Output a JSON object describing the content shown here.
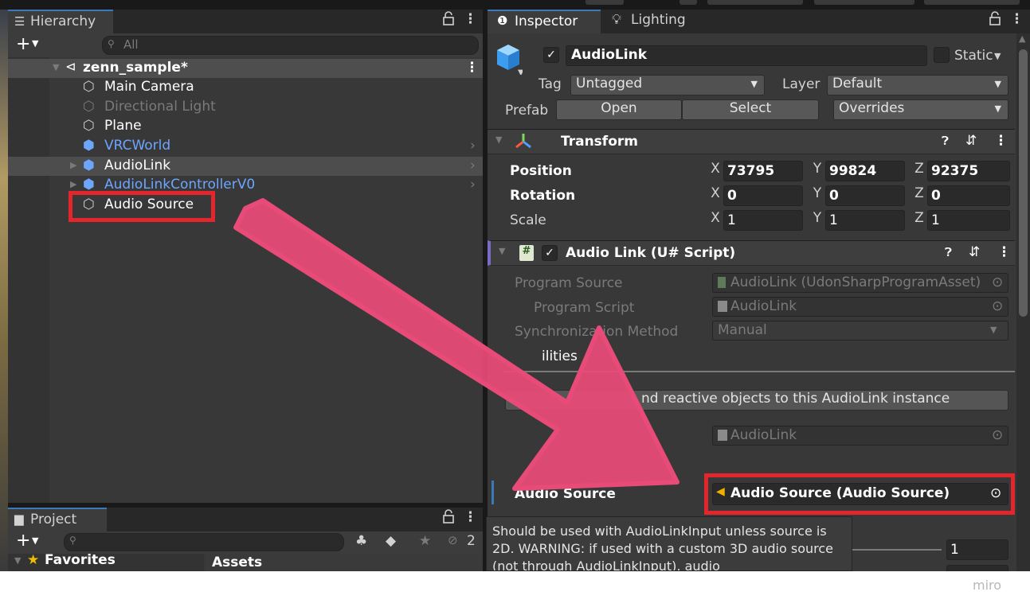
{
  "hierarchy": {
    "tab_label": "Hierarchy",
    "search_placeholder": "All",
    "scene_name": "zenn_sample*",
    "items": [
      {
        "label": "Main Camera"
      },
      {
        "label": "Directional Light"
      },
      {
        "label": "Plane"
      },
      {
        "label": "VRCWorld"
      },
      {
        "label": "AudioLink"
      },
      {
        "label": "AudioLinkControllerV0"
      },
      {
        "label": "Audio Source"
      }
    ]
  },
  "project": {
    "tab_label": "Project",
    "hidden_count": "2",
    "favorites_label": "Favorites",
    "assets_label": "Assets"
  },
  "inspector": {
    "tabs": [
      "Inspector",
      "Lighting"
    ],
    "object_name": "AudioLink",
    "static_label": "Static",
    "tag_label": "Tag",
    "tag_value": "Untagged",
    "layer_label": "Layer",
    "layer_value": "Default",
    "prefab_label": "Prefab",
    "open_label": "Open",
    "select_label": "Select",
    "overrides_label": "Overrides",
    "transform": {
      "title": "Transform",
      "position_label": "Position",
      "rotation_label": "Rotation",
      "scale_label": "Scale",
      "axes": [
        "X",
        "Y",
        "Z"
      ],
      "position": [
        "73795",
        "99824",
        "92375"
      ],
      "rotation": [
        "0",
        "0",
        "0"
      ],
      "scale": [
        "1",
        "1",
        "1"
      ]
    },
    "script": {
      "title": "Audio Link (U# Script)",
      "program_source_label": "Program Source",
      "program_source_value": "AudioLink (UdonSharpProgramAsset)",
      "program_script_label": "Program Script",
      "program_script_value": "AudioLink",
      "sync_label": "Synchronization Method",
      "sync_value": "Manual",
      "utilities_label": "ilities",
      "link_button": "nd reactive objects to this AudioLink instance",
      "script_ref_value": "AudioLink",
      "audio_source_label": "Audio Source",
      "audio_source_value": "Audio Source (Audio Source)",
      "tooltip": "Should be used with AudioLinkInput unless source is 2D. WARNING: if used with a custom 3D audio source (not through AudioLinkInput), audio",
      "slider_value": "1"
    }
  },
  "watermark": "miro",
  "colors": {
    "highlight_box": "#e3262b",
    "arrow": "#e84b78",
    "accent_blue": "#6ca6ff"
  }
}
